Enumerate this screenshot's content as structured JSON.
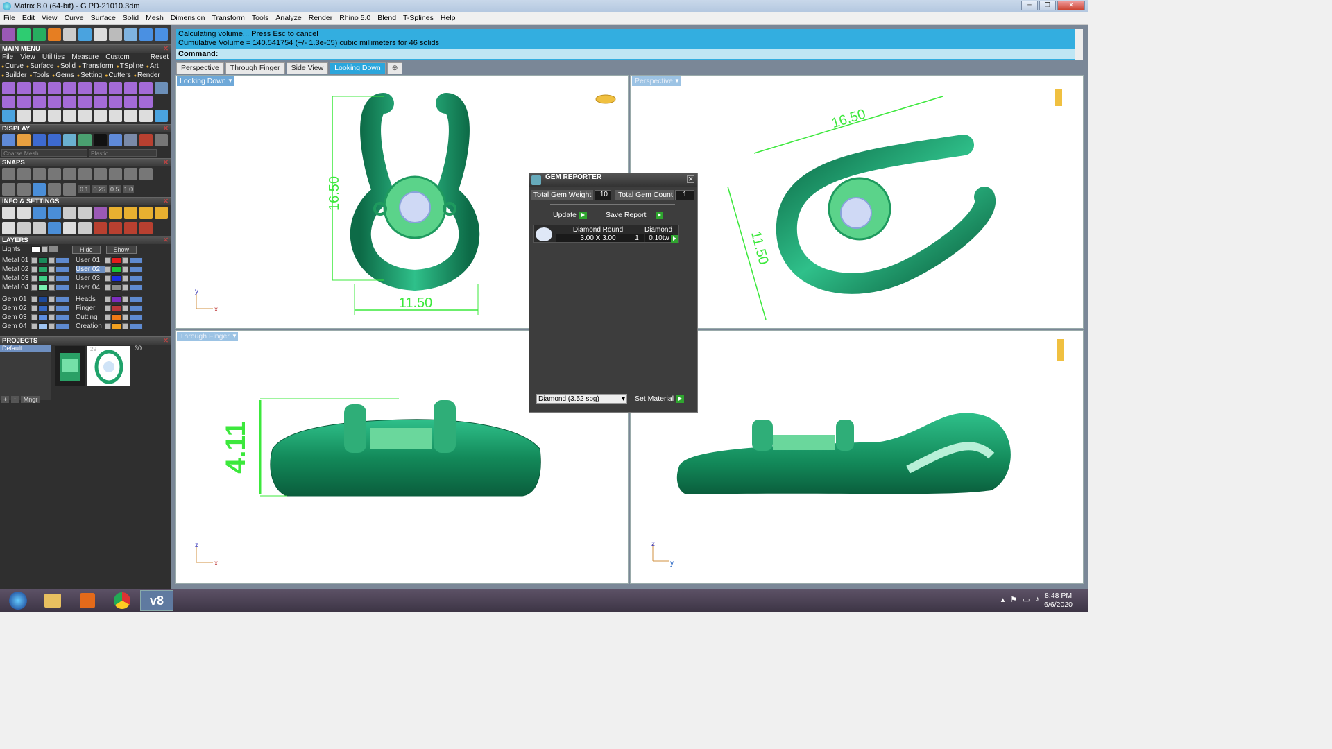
{
  "window": {
    "title": "Matrix 8.0 (64-bit) - G PD-21010.3dm"
  },
  "menubar": [
    "File",
    "Edit",
    "View",
    "Curve",
    "Surface",
    "Solid",
    "Mesh",
    "Dimension",
    "Transform",
    "Tools",
    "Analyze",
    "Render",
    "Rhino 5.0",
    "Blend",
    "T-Splines",
    "Help"
  ],
  "left": {
    "main_menu": {
      "title": "MAIN MENU",
      "items": [
        "File",
        "View",
        "Utilities",
        "Measure",
        "Custom"
      ],
      "reset": "Reset"
    },
    "categories1": [
      "Curve",
      "Surface",
      "Solid",
      "Transform",
      "TSpline",
      "Art"
    ],
    "categories2": [
      "Builder",
      "Tools",
      "Gems",
      "Setting",
      "Cutters",
      "Render"
    ],
    "display": {
      "title": "DISPLAY",
      "mesh": "Coarse Mesh",
      "material": "Plastic"
    },
    "snaps": {
      "title": "SNAPS",
      "values": [
        "0.1",
        "0.25",
        "0.5",
        "1.0"
      ]
    },
    "info": {
      "title": "INFO & SETTINGS"
    },
    "layers": {
      "title": "LAYERS",
      "lights": "Lights",
      "hide": "Hide",
      "show": "Show",
      "left": [
        {
          "name": "Metal 01",
          "color": "#1a8a5a"
        },
        {
          "name": "Metal 02",
          "color": "#27a86a"
        },
        {
          "name": "Metal 03",
          "color": "#3fcf86"
        },
        {
          "name": "Metal 04",
          "color": "#79f0b0"
        },
        {
          "name": "Gem 01",
          "color": "#1d4a9c"
        },
        {
          "name": "Gem 02",
          "color": "#3568c4"
        },
        {
          "name": "Gem 03",
          "color": "#5d8ee0"
        },
        {
          "name": "Gem 04",
          "color": "#9ec4f2"
        }
      ],
      "right": [
        {
          "name": "User 01",
          "color": "#e21c1c"
        },
        {
          "name": "User 02",
          "color": "#19c43a"
        },
        {
          "name": "User 03",
          "color": "#1b2fe0"
        },
        {
          "name": "User 04",
          "color": "#8a8a8a"
        },
        {
          "name": "Heads",
          "color": "#7b2dbd"
        },
        {
          "name": "Finger",
          "color": "#b8373a"
        },
        {
          "name": "Cutting",
          "color": "#f07a16"
        },
        {
          "name": "Creation",
          "color": "#f0a020"
        }
      ]
    },
    "projects": {
      "title": "PROJECTS",
      "default": "Default",
      "thumb1_num": "29",
      "thumb2_num": "30",
      "mgr": "Mngr"
    }
  },
  "command": {
    "line1": "Calculating volume... Press Esc to cancel",
    "line2": "Cumulative Volume = 140.541754 (+/- 1.3e-05) cubic millimeters for 46 solids",
    "prompt": "Command:"
  },
  "tabs": [
    "Perspective",
    "Through Finger",
    "Side View",
    "Looking Down"
  ],
  "active_tab": "Looking Down",
  "viewports": {
    "top_left": {
      "label": "Looking Down",
      "dim_h": "16.50",
      "dim_w": "11.50",
      "axis_v": "y",
      "axis_h": "x"
    },
    "top_right": {
      "label": "Perspective",
      "dim_a": "16.50",
      "dim_b": "11.50"
    },
    "bottom_left": {
      "label": "Through Finger",
      "dim": "4.11",
      "axis_v": "z",
      "axis_h": "x"
    },
    "bottom_right": {
      "axis_v": "z",
      "axis_h": "y"
    }
  },
  "gem_reporter": {
    "title": "GEM REPORTER",
    "total_weight_label": "Total Gem Weight",
    "total_weight": ".10",
    "total_count_label": "Total Gem Count",
    "total_count": "1",
    "update": "Update",
    "save_report": "Save Report",
    "row": {
      "name": "Diamond Round",
      "size": "3.00 X 3.00",
      "material": "Diamond",
      "count": "1",
      "tw": "0.10tw"
    },
    "material_select": "Diamond    (3.52 spg)",
    "set_material": "Set Material"
  },
  "taskbar": {
    "time": "8:48 PM",
    "date": "6/6/2020"
  }
}
